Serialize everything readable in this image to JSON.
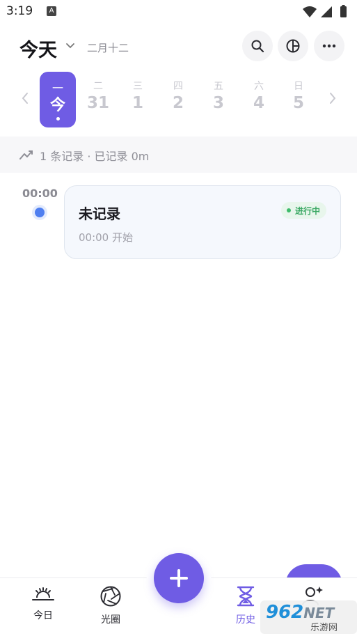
{
  "status_bar": {
    "time": "3:19",
    "notification_glyph": "A"
  },
  "header": {
    "title": "今天",
    "lunar_date": "二月十二",
    "buttons": [
      "search-icon",
      "chart-icon",
      "more-icon"
    ]
  },
  "week": {
    "days": [
      {
        "weekday": "一",
        "date": "今",
        "active": true
      },
      {
        "weekday": "二",
        "date": "31"
      },
      {
        "weekday": "三",
        "date": "1"
      },
      {
        "weekday": "四",
        "date": "2"
      },
      {
        "weekday": "五",
        "date": "3"
      },
      {
        "weekday": "六",
        "date": "4"
      },
      {
        "weekday": "日",
        "date": "5"
      }
    ]
  },
  "summary": {
    "text": "1 条记录 · 已记录 0m"
  },
  "timeline": {
    "time": "00:00",
    "record": {
      "title": "未记录",
      "subtitle": "00:00 开始",
      "status": "进行中"
    }
  },
  "bottom_nav": {
    "items": [
      {
        "label": "今日",
        "icon": "sunrise-icon"
      },
      {
        "label": "光圈",
        "icon": "aperture-icon"
      },
      {
        "label": "历史",
        "icon": "hourglass-icon",
        "active": true
      }
    ]
  },
  "colors": {
    "accent": "#6f5ce4",
    "timeline_dot": "#4f7ff0",
    "status_green": "#3aa863"
  },
  "watermark": {
    "brand": "962",
    "suffix": "NET",
    "sub": "乐游网"
  }
}
